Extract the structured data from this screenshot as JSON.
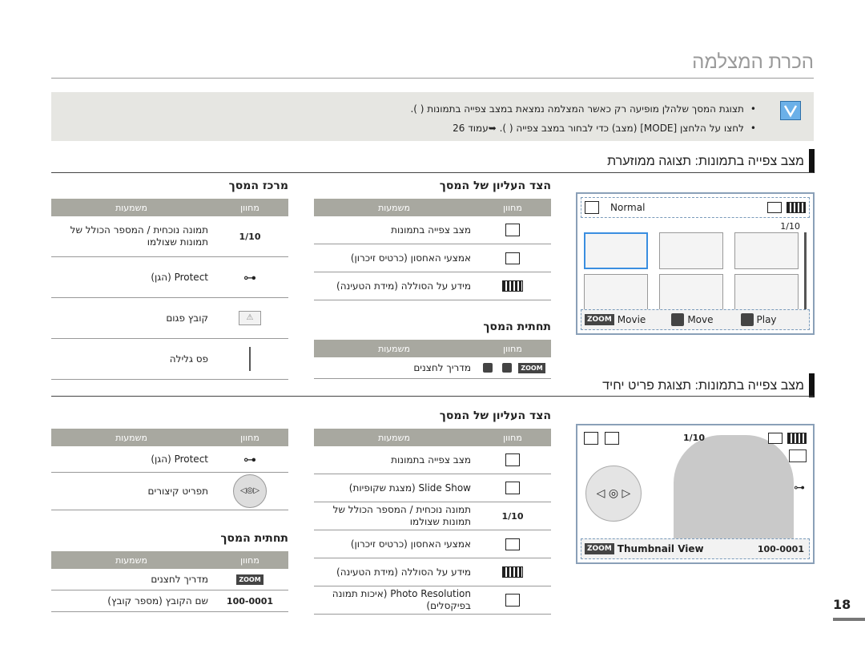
{
  "page": {
    "title": "הכרת המצלמה",
    "number": "18"
  },
  "note": {
    "line1": "תצוגת המסך שלהלן מופיעה רק כאשר המצלמה נמצאת במצב צפייה בתמונות (  ).",
    "line2": "לחצו על הלחצן [MODE] (מצב) כדי לבחור במצב צפייה (  ). ➥עמוד 26"
  },
  "section1": {
    "heading": "מצב צפייה בתמונות: תצוגה ממוזערת",
    "top_table": {
      "heading": "הצד העליון של המסך",
      "col_icon": "מחוון",
      "col_meaning": "משמעות",
      "rows": [
        {
          "text": "מצב צפייה בתמונות",
          "icon": "playback-photo-icon"
        },
        {
          "text": "אמצעי האחסון (כרטיס זיכרון)",
          "icon": "memory-card-icon"
        },
        {
          "text": "מידע על הסוללה (מידת הטעינה)",
          "icon": "battery-icon"
        }
      ]
    },
    "center_table": {
      "heading": "מרכז המסך",
      "col_icon": "מחוון",
      "col_meaning": "משמעות",
      "rows": [
        {
          "value": "1/10",
          "text": "תמונה נוכחית / המספר הכולל של תמונות שצולמו",
          "icon": ""
        },
        {
          "text": "Protect (הגן)",
          "icon": "protect-key-icon"
        },
        {
          "text": "קובץ פגום",
          "icon": "damaged-file-icon"
        },
        {
          "text": "פס גלילה",
          "icon": "scroll-bar-icon"
        }
      ]
    },
    "bottom_table": {
      "heading": "תחתית המסך",
      "col_icon": "מחוון",
      "col_meaning": "משמעות",
      "rows": [
        {
          "text": "מדריך לחצנים",
          "icon": "button-guide-icons"
        }
      ]
    },
    "lcd": {
      "mode_label": "Normal",
      "counter": "1/10",
      "bottom_movie": "Movie",
      "bottom_move": "Move",
      "bottom_play": "Play",
      "zoom": "ZOOM"
    }
  },
  "section2": {
    "heading": "מצב צפייה בתמונות: תצוגת פריט יחיד",
    "top_table": {
      "heading": "הצד העליון של המסך",
      "col_icon": "מחוון",
      "col_meaning": "משמעות",
      "rows": [
        {
          "text": "מצב צפייה בתמונות",
          "icon": "playback-photo-icon"
        },
        {
          "text": "Slide Show (מצגת שקופיות)",
          "icon": "slideshow-icon"
        },
        {
          "value": "1/10",
          "text": "תמונה נוכחית / המספר הכולל של תמונות שצולמו",
          "icon": ""
        },
        {
          "text": "אמצעי האחסון (כרטיס זיכרון)",
          "icon": "memory-card-icon"
        },
        {
          "text": "מידע על הסוללה (מידת הטעינה)",
          "icon": "battery-icon"
        },
        {
          "text": "Photo Resolution (איכות תמונה בפיקסלים)",
          "icon": "photo-resolution-icon"
        }
      ]
    },
    "center_table": {
      "col_icon": "מחוון",
      "col_meaning": "משמעות",
      "rows": [
        {
          "text": "Protect (הגן)",
          "icon": "protect-key-icon"
        },
        {
          "text": "תפריט קיצורים",
          "icon": "shortcut-dial-icon"
        }
      ]
    },
    "bottom_table": {
      "heading": "תחתית המסך",
      "col_icon": "מחוון",
      "col_meaning": "משמעות",
      "rows": [
        {
          "text": "מדריך לחצנים",
          "icon": "zoom-icon"
        },
        {
          "value": "100-0001",
          "text": "שם הקובץ (מספר קובץ)",
          "icon": ""
        }
      ]
    },
    "lcd": {
      "counter": "1/10",
      "bottom_label": "Thumbnail View",
      "file_number": "100-0001",
      "zoom": "ZOOM"
    }
  }
}
